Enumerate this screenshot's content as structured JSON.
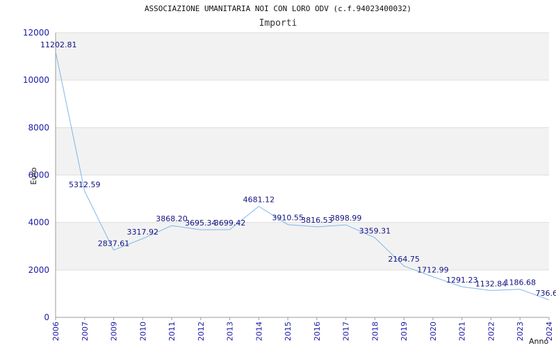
{
  "chart_data": {
    "type": "line",
    "title": "ASSOCIAZIONE UMANITARIA NOI CON LORO ODV (c.f.94023400032)",
    "subtitle": "Importi",
    "xlabel": "Anno",
    "ylabel": "Euro",
    "ylim": [
      0,
      12000
    ],
    "yticks": [
      0,
      2000,
      4000,
      6000,
      8000,
      10000,
      12000
    ],
    "grid": true,
    "categories": [
      "2006",
      "2007",
      "2009",
      "2010",
      "2011",
      "2012",
      "2013",
      "2014",
      "2015",
      "2016",
      "2017",
      "2018",
      "2019",
      "2020",
      "2021",
      "2022",
      "2023",
      "2024"
    ],
    "series": [
      {
        "values": [
          11202.81,
          5312.59,
          2837.61,
          3317.92,
          3868.2,
          3695.34,
          3699.42,
          4681.12,
          3910.55,
          3816.53,
          3898.99,
          3359.31,
          2164.75,
          1712.99,
          1291.23,
          1132.84,
          1186.68,
          736.6
        ],
        "labels": [
          "11202.81",
          "5312.59",
          "2837.61",
          "3317.92",
          "3868.20",
          "3695.34",
          "3699.42",
          "4681.12",
          "3910.55",
          "3816.53",
          "3898.99",
          "3359.31",
          "2164.75",
          "1712.99",
          "1291.23",
          "1132.84",
          "1186.68",
          "736.6"
        ]
      }
    ],
    "colors": {
      "line": "#7eb6ea",
      "band": "#f2f2f2",
      "grid": "#dddddd",
      "tick_text": "#1a1aa6",
      "label_text": "#101080"
    }
  }
}
